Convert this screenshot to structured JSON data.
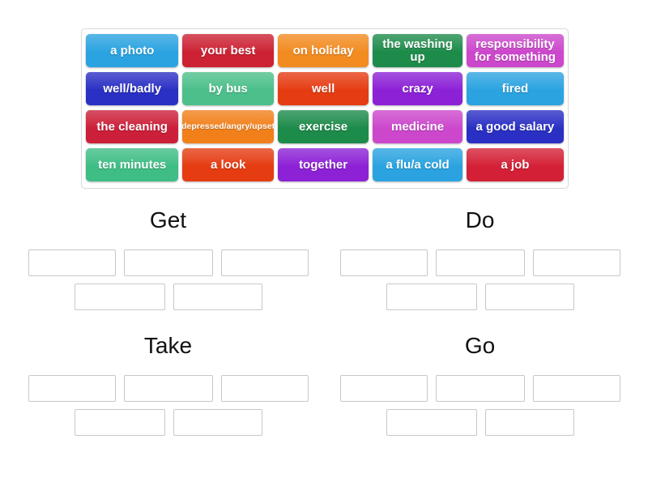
{
  "word_bank": {
    "name": "word-bank",
    "rows": [
      [
        {
          "label": "a photo",
          "color": "#2aa3e0",
          "size": "normal"
        },
        {
          "label": "your best",
          "color": "#cc2233",
          "size": "normal"
        },
        {
          "label": "on holiday",
          "color": "#f28b20",
          "size": "normal"
        },
        {
          "label": "the washing up",
          "color": "#1d8b4a",
          "size": "normal"
        },
        {
          "label": "responsibility for something",
          "color": "#cc47cc",
          "size": "normal"
        }
      ],
      [
        {
          "label": "well/badly",
          "color": "#2a30c4",
          "size": "normal"
        },
        {
          "label": "by bus",
          "color": "#4cbf8a",
          "size": "normal"
        },
        {
          "label": "well",
          "color": "#e53c12",
          "size": "normal"
        },
        {
          "label": "crazy",
          "color": "#8c21d6",
          "size": "normal"
        },
        {
          "label": "fired",
          "color": "#2aa3e0",
          "size": "normal"
        }
      ],
      [
        {
          "label": "the cleaning",
          "color": "#cc1f39",
          "size": "normal"
        },
        {
          "label": "depressed/angry/upset",
          "color": "#f2801a",
          "size": "small"
        },
        {
          "label": "exercise",
          "color": "#1d8b4a",
          "size": "normal"
        },
        {
          "label": "medicine",
          "color": "#cc47cc",
          "size": "normal"
        },
        {
          "label": "a good salary",
          "color": "#2a30c4",
          "size": "normal"
        }
      ],
      [
        {
          "label": "ten minutes",
          "color": "#3ebd85",
          "size": "normal"
        },
        {
          "label": "a look",
          "color": "#e53c12",
          "size": "normal"
        },
        {
          "label": "together",
          "color": "#8c21d6",
          "size": "normal"
        },
        {
          "label": "a flu/a cold",
          "color": "#2aa3e0",
          "size": "normal"
        },
        {
          "label": "a job",
          "color": "#d42036",
          "size": "normal"
        }
      ]
    ]
  },
  "groups": [
    {
      "id": "get",
      "title": "Get",
      "slots_row1": 3,
      "slots_row2": 2
    },
    {
      "id": "do",
      "title": "Do",
      "slots_row1": 3,
      "slots_row2": 2
    },
    {
      "id": "take",
      "title": "Take",
      "slots_row1": 3,
      "slots_row2": 2
    },
    {
      "id": "go",
      "title": "Go",
      "slots_row1": 3,
      "slots_row2": 2
    }
  ],
  "theme": {
    "page_background": "#ffffff",
    "bank_border": "#d8d8d8",
    "slot_border": "#c8c8c8",
    "title_color": "#111111",
    "tile_text_color": "#ffffff"
  }
}
